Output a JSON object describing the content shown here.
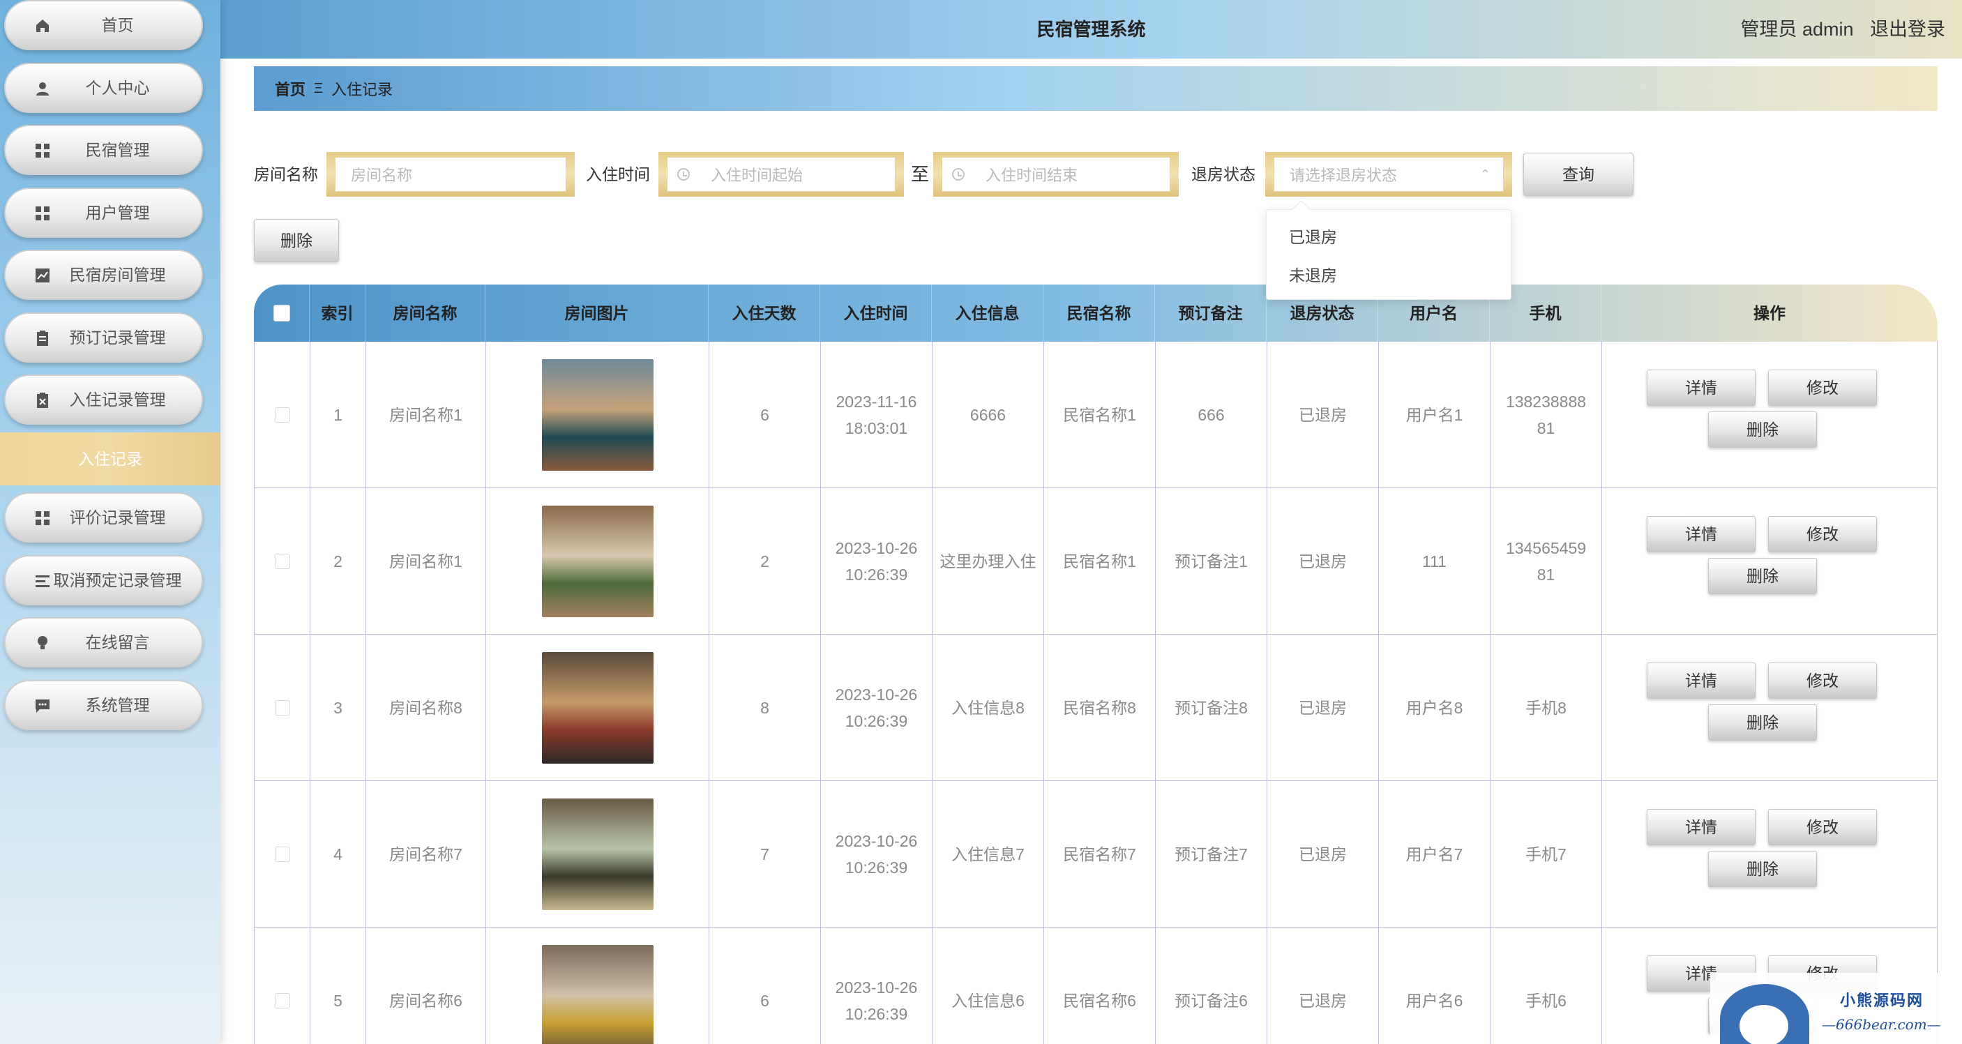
{
  "app": {
    "title": "民宿管理系统",
    "user_label": "管理员 admin",
    "logout_label": "退出登录"
  },
  "sidebar": {
    "items": [
      {
        "label": "首页",
        "icon": "home-icon"
      },
      {
        "label": "个人中心",
        "icon": "user-icon"
      },
      {
        "label": "民宿管理",
        "icon": "grid-icon"
      },
      {
        "label": "用户管理",
        "icon": "grid-icon"
      },
      {
        "label": "民宿房间管理",
        "icon": "chart-icon"
      },
      {
        "label": "预订记录管理",
        "icon": "clipboard-icon"
      },
      {
        "label": "入住记录管理",
        "icon": "clipboard-x-icon"
      },
      {
        "label": "评价记录管理",
        "icon": "grid-icon"
      },
      {
        "label": "取消预定记录管理",
        "icon": "list-icon"
      },
      {
        "label": "在线留言",
        "icon": "bulb-icon"
      },
      {
        "label": "系统管理",
        "icon": "message-icon"
      }
    ],
    "active_sub": "入住记录"
  },
  "breadcrumb": {
    "home": "首页",
    "separator": "Ξ",
    "current": "入住记录"
  },
  "search": {
    "room_name_label": "房间名称",
    "room_name_placeholder": "房间名称",
    "checkin_label": "入住时间",
    "start_placeholder": "入住时间起始",
    "to_label": "至",
    "end_placeholder": "入住时间结束",
    "status_label": "退房状态",
    "status_placeholder": "请选择退房状态",
    "query_button": "查询",
    "delete_button": "删除"
  },
  "dropdown": {
    "options": [
      "已退房",
      "未退房"
    ]
  },
  "table": {
    "headers": [
      "索引",
      "房间名称",
      "房间图片",
      "入住天数",
      "入住时间",
      "入住信息",
      "民宿名称",
      "预订备注",
      "退房状态",
      "用户名",
      "手机",
      "操作"
    ],
    "rows": [
      {
        "index": "1",
        "room": "房间名称1",
        "days": "6",
        "time1": "2023-11-16",
        "time2": "18:03:01",
        "info": "6666",
        "bnb": "民宿名称1",
        "note": "666",
        "status": "已退房",
        "user": "用户名1",
        "phone1": "138238888",
        "phone2": "81"
      },
      {
        "index": "2",
        "room": "房间名称1",
        "days": "2",
        "time1": "2023-10-26",
        "time2": "10:26:39",
        "info": "这里办理入住",
        "bnb": "民宿名称1",
        "note": "预订备注1",
        "status": "已退房",
        "user": "111",
        "phone1": "134565459",
        "phone2": "81"
      },
      {
        "index": "3",
        "room": "房间名称8",
        "days": "8",
        "time1": "2023-10-26",
        "time2": "10:26:39",
        "info": "入住信息8",
        "bnb": "民宿名称8",
        "note": "预订备注8",
        "status": "已退房",
        "user": "用户名8",
        "phone1": "手机8",
        "phone2": ""
      },
      {
        "index": "4",
        "room": "房间名称7",
        "days": "7",
        "time1": "2023-10-26",
        "time2": "10:26:39",
        "info": "入住信息7",
        "bnb": "民宿名称7",
        "note": "预订备注7",
        "status": "已退房",
        "user": "用户名7",
        "phone1": "手机7",
        "phone2": ""
      },
      {
        "index": "5",
        "room": "房间名称6",
        "days": "6",
        "time1": "2023-10-26",
        "time2": "10:26:39",
        "info": "入住信息6",
        "bnb": "民宿名称6",
        "note": "预订备注6",
        "status": "已退房",
        "user": "用户名6",
        "phone1": "手机6",
        "phone2": ""
      }
    ],
    "actions": {
      "detail": "详情",
      "edit": "修改",
      "delete": "删除"
    }
  },
  "watermark": {
    "title": "小熊源码网",
    "subtitle": "—666bear.com—"
  },
  "colors": {
    "sidebar_top": "#6fb1dd",
    "accent_gold": "#f0d79b",
    "header_blue": "#5d9fd0",
    "table_border": "#b9bfdb"
  }
}
